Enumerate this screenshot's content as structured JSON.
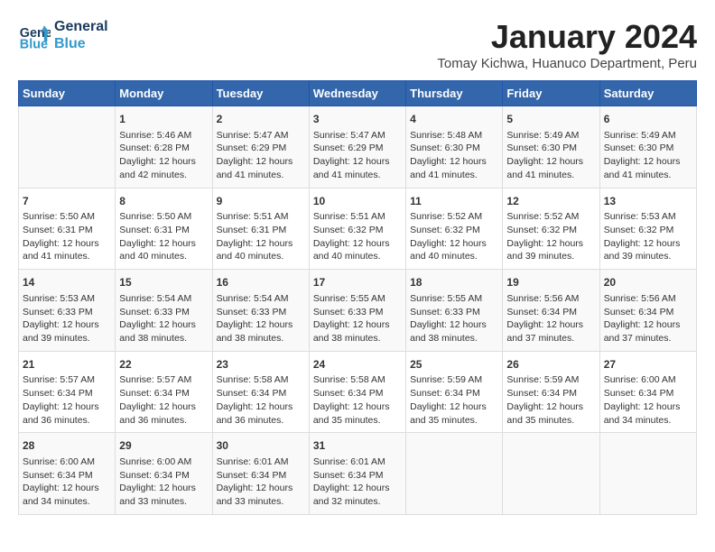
{
  "logo": {
    "line1": "General",
    "line2": "Blue"
  },
  "title": "January 2024",
  "subtitle": "Tomay Kichwa, Huanuco Department, Peru",
  "days_header": [
    "Sunday",
    "Monday",
    "Tuesday",
    "Wednesday",
    "Thursday",
    "Friday",
    "Saturday"
  ],
  "weeks": [
    [
      {
        "num": "",
        "info": ""
      },
      {
        "num": "1",
        "info": "Sunrise: 5:46 AM\nSunset: 6:28 PM\nDaylight: 12 hours\nand 42 minutes."
      },
      {
        "num": "2",
        "info": "Sunrise: 5:47 AM\nSunset: 6:29 PM\nDaylight: 12 hours\nand 41 minutes."
      },
      {
        "num": "3",
        "info": "Sunrise: 5:47 AM\nSunset: 6:29 PM\nDaylight: 12 hours\nand 41 minutes."
      },
      {
        "num": "4",
        "info": "Sunrise: 5:48 AM\nSunset: 6:30 PM\nDaylight: 12 hours\nand 41 minutes."
      },
      {
        "num": "5",
        "info": "Sunrise: 5:49 AM\nSunset: 6:30 PM\nDaylight: 12 hours\nand 41 minutes."
      },
      {
        "num": "6",
        "info": "Sunrise: 5:49 AM\nSunset: 6:30 PM\nDaylight: 12 hours\nand 41 minutes."
      }
    ],
    [
      {
        "num": "7",
        "info": "Sunrise: 5:50 AM\nSunset: 6:31 PM\nDaylight: 12 hours\nand 41 minutes."
      },
      {
        "num": "8",
        "info": "Sunrise: 5:50 AM\nSunset: 6:31 PM\nDaylight: 12 hours\nand 40 minutes."
      },
      {
        "num": "9",
        "info": "Sunrise: 5:51 AM\nSunset: 6:31 PM\nDaylight: 12 hours\nand 40 minutes."
      },
      {
        "num": "10",
        "info": "Sunrise: 5:51 AM\nSunset: 6:32 PM\nDaylight: 12 hours\nand 40 minutes."
      },
      {
        "num": "11",
        "info": "Sunrise: 5:52 AM\nSunset: 6:32 PM\nDaylight: 12 hours\nand 40 minutes."
      },
      {
        "num": "12",
        "info": "Sunrise: 5:52 AM\nSunset: 6:32 PM\nDaylight: 12 hours\nand 39 minutes."
      },
      {
        "num": "13",
        "info": "Sunrise: 5:53 AM\nSunset: 6:32 PM\nDaylight: 12 hours\nand 39 minutes."
      }
    ],
    [
      {
        "num": "14",
        "info": "Sunrise: 5:53 AM\nSunset: 6:33 PM\nDaylight: 12 hours\nand 39 minutes."
      },
      {
        "num": "15",
        "info": "Sunrise: 5:54 AM\nSunset: 6:33 PM\nDaylight: 12 hours\nand 38 minutes."
      },
      {
        "num": "16",
        "info": "Sunrise: 5:54 AM\nSunset: 6:33 PM\nDaylight: 12 hours\nand 38 minutes."
      },
      {
        "num": "17",
        "info": "Sunrise: 5:55 AM\nSunset: 6:33 PM\nDaylight: 12 hours\nand 38 minutes."
      },
      {
        "num": "18",
        "info": "Sunrise: 5:55 AM\nSunset: 6:33 PM\nDaylight: 12 hours\nand 38 minutes."
      },
      {
        "num": "19",
        "info": "Sunrise: 5:56 AM\nSunset: 6:34 PM\nDaylight: 12 hours\nand 37 minutes."
      },
      {
        "num": "20",
        "info": "Sunrise: 5:56 AM\nSunset: 6:34 PM\nDaylight: 12 hours\nand 37 minutes."
      }
    ],
    [
      {
        "num": "21",
        "info": "Sunrise: 5:57 AM\nSunset: 6:34 PM\nDaylight: 12 hours\nand 36 minutes."
      },
      {
        "num": "22",
        "info": "Sunrise: 5:57 AM\nSunset: 6:34 PM\nDaylight: 12 hours\nand 36 minutes."
      },
      {
        "num": "23",
        "info": "Sunrise: 5:58 AM\nSunset: 6:34 PM\nDaylight: 12 hours\nand 36 minutes."
      },
      {
        "num": "24",
        "info": "Sunrise: 5:58 AM\nSunset: 6:34 PM\nDaylight: 12 hours\nand 35 minutes."
      },
      {
        "num": "25",
        "info": "Sunrise: 5:59 AM\nSunset: 6:34 PM\nDaylight: 12 hours\nand 35 minutes."
      },
      {
        "num": "26",
        "info": "Sunrise: 5:59 AM\nSunset: 6:34 PM\nDaylight: 12 hours\nand 35 minutes."
      },
      {
        "num": "27",
        "info": "Sunrise: 6:00 AM\nSunset: 6:34 PM\nDaylight: 12 hours\nand 34 minutes."
      }
    ],
    [
      {
        "num": "28",
        "info": "Sunrise: 6:00 AM\nSunset: 6:34 PM\nDaylight: 12 hours\nand 34 minutes."
      },
      {
        "num": "29",
        "info": "Sunrise: 6:00 AM\nSunset: 6:34 PM\nDaylight: 12 hours\nand 33 minutes."
      },
      {
        "num": "30",
        "info": "Sunrise: 6:01 AM\nSunset: 6:34 PM\nDaylight: 12 hours\nand 33 minutes."
      },
      {
        "num": "31",
        "info": "Sunrise: 6:01 AM\nSunset: 6:34 PM\nDaylight: 12 hours\nand 32 minutes."
      },
      {
        "num": "",
        "info": ""
      },
      {
        "num": "",
        "info": ""
      },
      {
        "num": "",
        "info": ""
      }
    ]
  ]
}
